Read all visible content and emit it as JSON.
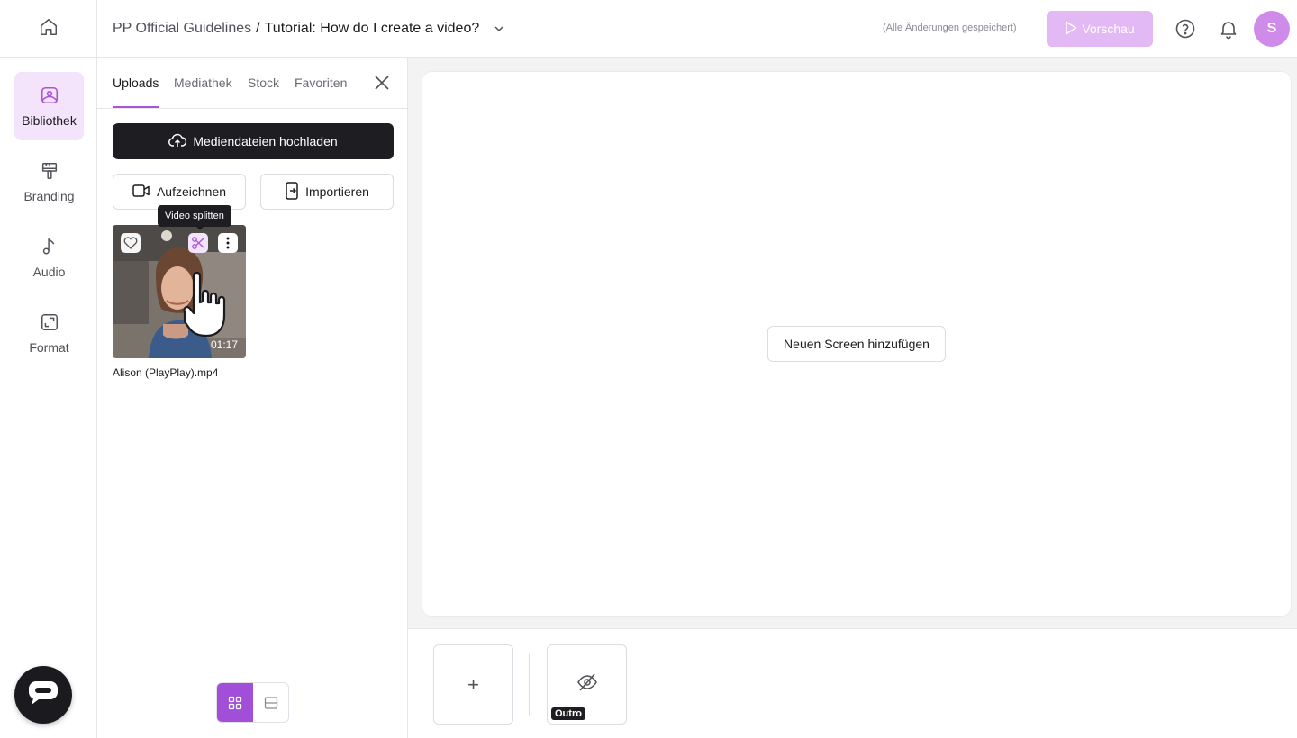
{
  "header": {
    "project_name": "PP Official Guidelines",
    "separator": "/",
    "video_title": "Tutorial: How do I create a video?",
    "save_status": "(Alle Änderungen gespeichert)",
    "preview_label": "Vorschau",
    "avatar_initial": "S",
    "icons": [
      "home-icon",
      "chevron-down-icon",
      "play-icon",
      "help-icon",
      "bell-icon"
    ]
  },
  "sidebar": {
    "items": [
      {
        "label": "Bibliothek",
        "icon": "image-icon",
        "active": true
      },
      {
        "label": "Branding",
        "icon": "paint-roller-icon",
        "active": false
      },
      {
        "label": "Audio",
        "icon": "music-note-icon",
        "active": false
      },
      {
        "label": "Format",
        "icon": "resize-icon",
        "active": false
      }
    ],
    "chat_icon": "chat-icon"
  },
  "library": {
    "tabs": [
      "Uploads",
      "Mediathek",
      "Stock",
      "Favoriten"
    ],
    "active_tab": "Uploads",
    "upload_button": "Mediendateien hochladen",
    "record_button": "Aufzeichnen",
    "import_button": "Importieren",
    "media": [
      {
        "name": "Alison (PlayPlay).mp4",
        "duration": "01:17",
        "tooltip": "Video splitten"
      }
    ],
    "view_modes": [
      "grid-view-icon",
      "list-view-icon"
    ],
    "active_view": "grid"
  },
  "canvas": {
    "add_screen_label": "Neuen Screen hinzufügen"
  },
  "timeline": {
    "add_label": "+",
    "outro_label": "Outro"
  },
  "colors": {
    "accent": "#a854d6",
    "preview_button": "#e2b9f4",
    "avatar": "#cf8bea",
    "dark_button": "#1e1e22"
  }
}
